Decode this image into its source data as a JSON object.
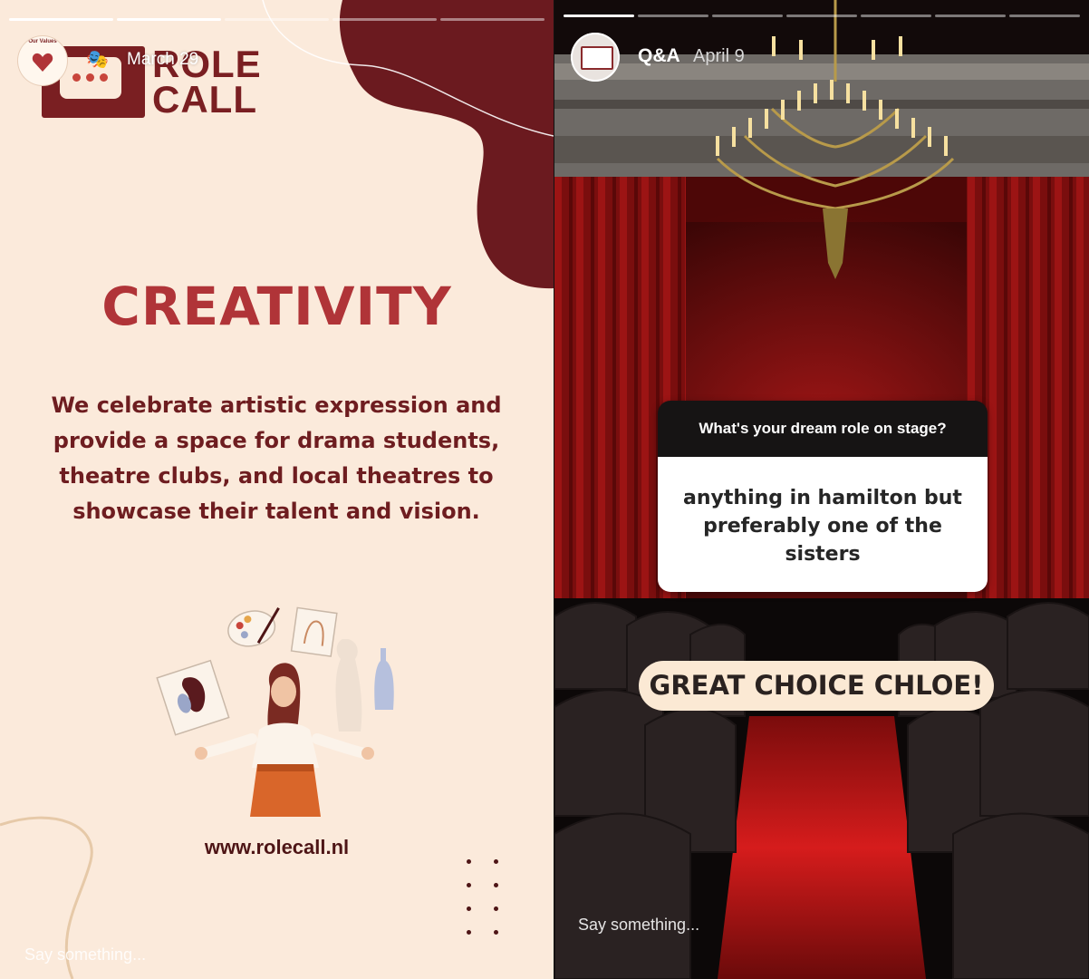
{
  "left_story": {
    "progress_segments": 5,
    "progress_done": 2,
    "avatar_caption": "Our Values",
    "date": "March 29",
    "logo": {
      "line1": "ROLE",
      "line2": "CALL"
    },
    "title": "CREATIVITY",
    "body": "We celebrate artistic expression and provide a space for drama students, theatre clubs, and local theatres to showcase their talent and vision.",
    "url": "www.rolecall.nl",
    "reply_placeholder": "Say something...",
    "colors": {
      "maroon": "#6b1a1f",
      "accent": "#b03438",
      "background": "#fbeadb"
    }
  },
  "right_story": {
    "progress_segments": 7,
    "progress_done": 1,
    "account_name": "Q&A",
    "date": "April 9",
    "question": "What's your dream role on stage?",
    "answer": "anything in hamilton but preferably one of the sisters",
    "sticker_text": "GREAT CHOICE CHLOE!",
    "reply_placeholder": "Say something...",
    "colors": {
      "curtain": "#8c1010",
      "card_header": "#161414",
      "pill": "#fbe9d4"
    }
  }
}
